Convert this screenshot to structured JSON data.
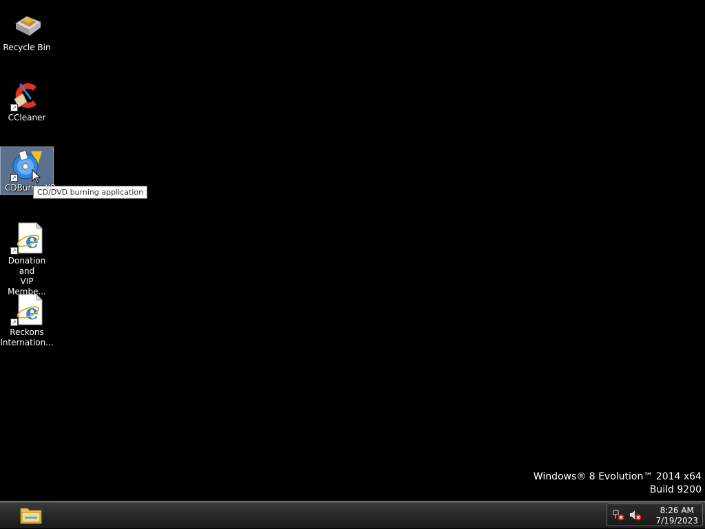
{
  "desktop": {
    "icons": [
      {
        "label": "Recycle Bin",
        "icon": "recycle-bin-icon"
      },
      {
        "label": "CCleaner",
        "icon": "ccleaner-icon"
      },
      {
        "label": "CDBurnerXP",
        "icon": "cdburnerxp-icon"
      },
      {
        "label": "Donation and\nVIP Membe...",
        "icon": "internet-explorer-icon"
      },
      {
        "label": "Reckons\nInternation...",
        "icon": "internet-explorer-icon"
      }
    ],
    "tooltip": "CD/DVD burning application",
    "watermark": {
      "line1": "Windows® 8 Evolution™ 2014 x64",
      "line2": "Build 9200"
    }
  },
  "taskbar": {
    "pinned": [
      {
        "icon": "file-explorer-icon"
      }
    ],
    "tray": {
      "icons": [
        "network-disconnected-icon",
        "volume-muted-icon"
      ],
      "time": "8:26 AM",
      "date": "7/19/2023"
    }
  },
  "colors": {
    "desktop_bg": "#000000",
    "selection": "#7896be",
    "taskbar": "#262626"
  }
}
